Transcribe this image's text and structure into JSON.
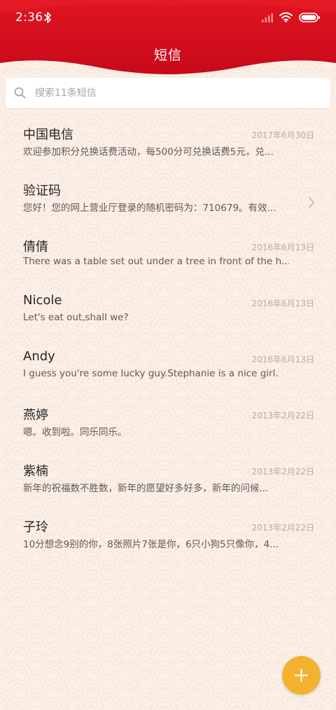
{
  "status_bar": {
    "time": "2:36",
    "icons": [
      "bluetooth-icon",
      "signal-icon",
      "wifi-icon",
      "battery-icon"
    ]
  },
  "header": {
    "title": "短信",
    "background_color": "#d9101c"
  },
  "search": {
    "placeholder": "搜索11条短信",
    "icon": "search-icon"
  },
  "conversations": [
    {
      "name": "中国电信",
      "date": "2017年6月30日",
      "preview": "欢迎参加积分兑换话费活动，每500分可兑换话费5元，兑..."
    },
    {
      "name": "验证码",
      "date": "",
      "preview": "您好！您的网上营业厅登录的随机密码为：710679。有效...",
      "icon": "chevron-right-icon"
    },
    {
      "name": "倩倩",
      "date": "2016年6月13日",
      "preview": "There was a table set out under a tree in front of the h..."
    },
    {
      "name": "Nicole",
      "date": "2016年6月13日",
      "preview": "Let's eat out,shall we?"
    },
    {
      "name": "Andy",
      "date": "2016年6月13日",
      "preview": "I guess you're some lucky guy.Stephanie is a nice girl."
    },
    {
      "name": "燕婷",
      "date": "2013年2月22日",
      "preview": "嗯。收到啦。同乐同乐。"
    },
    {
      "name": "紫楠",
      "date": "2013年2月22日",
      "preview": "新年的祝福数不胜数，新年的愿望好多好多，新年的问候..."
    },
    {
      "name": "子玲",
      "date": "2013年2月22日",
      "preview": "10分想念9别的你，8张照片7张是你，6只小狗5只像你，4..."
    }
  ],
  "fab": {
    "icon": "plus-icon",
    "color": "#f2b230"
  },
  "colors": {
    "accent_red": "#d9101c",
    "background": "#fbefe6",
    "fab_orange": "#f2b230"
  }
}
